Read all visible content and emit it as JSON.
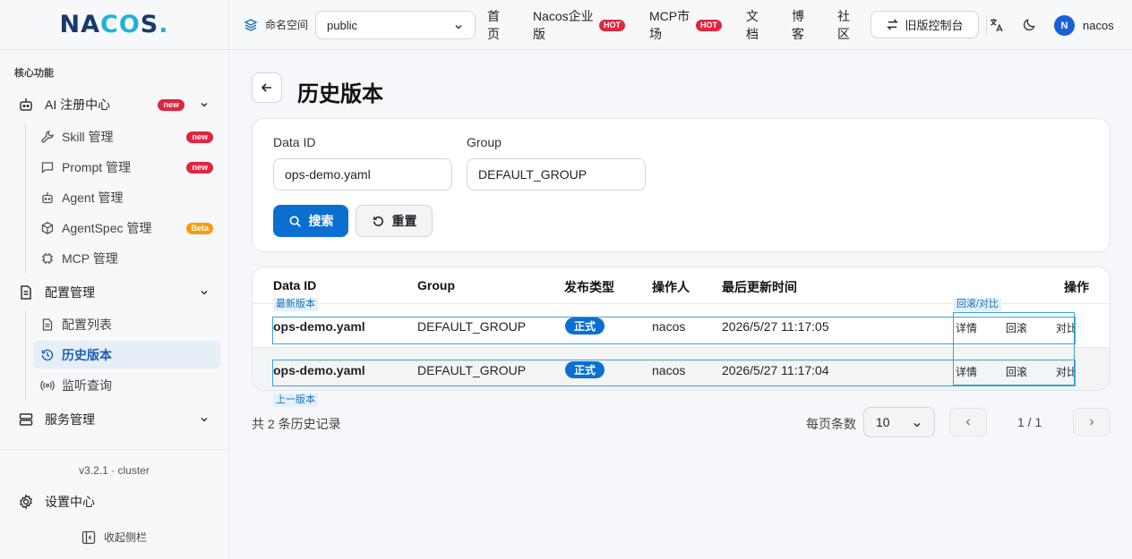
{
  "brand": {
    "logo": "NACOS."
  },
  "sidebar": {
    "section_title": "核心功能",
    "groups": [
      {
        "label": "AI 注册中心",
        "icon": "robot-icon",
        "badge": "new",
        "items": [
          {
            "label": "Skill 管理",
            "icon": "wrench-icon",
            "badge": "new"
          },
          {
            "label": "Prompt 管理",
            "icon": "chat-icon",
            "badge": "new"
          },
          {
            "label": "Agent 管理",
            "icon": "robot-icon"
          },
          {
            "label": "AgentSpec 管理",
            "icon": "cube-icon",
            "badge": "Beta"
          },
          {
            "label": "MCP 管理",
            "icon": "chip-icon"
          }
        ]
      },
      {
        "label": "配置管理",
        "icon": "file-icon",
        "items": [
          {
            "label": "配置列表",
            "icon": "file-icon"
          },
          {
            "label": "历史版本",
            "icon": "history-icon",
            "active": true
          },
          {
            "label": "监听查询",
            "icon": "radio-icon"
          }
        ]
      },
      {
        "label": "服务管理",
        "icon": "server-icon",
        "items": []
      }
    ],
    "version": "v3.2.1 · cluster",
    "settings": "设置中心",
    "collapse": "收起侧栏"
  },
  "header": {
    "namespace_label": "命名空间",
    "namespace_value": "public",
    "nav": [
      {
        "label": "首\n页"
      },
      {
        "label": "Nacos企业\n版",
        "badge": "HOT"
      },
      {
        "label": "MCP市\n场",
        "badge": "HOT"
      },
      {
        "label": "文\n档"
      },
      {
        "label": "博\n客"
      },
      {
        "label": "社\n区"
      }
    ],
    "legacy_console": "旧版控制台",
    "user": {
      "initial": "N",
      "name": "nacos"
    }
  },
  "page": {
    "title": "历史版本",
    "search": {
      "data_id_label": "Data ID",
      "data_id_value": "ops-demo.yaml",
      "group_label": "Group",
      "group_value": "DEFAULT_GROUP",
      "search_button": "搜索",
      "reset_button": "重置"
    },
    "table": {
      "columns": [
        "Data ID",
        "Group",
        "发布类型",
        "操作人",
        "最后更新时间",
        "操作"
      ],
      "rows": [
        {
          "data_id": "ops-demo.yaml",
          "group": "DEFAULT_GROUP",
          "type": "正式",
          "operator": "nacos",
          "updated": "2026/5/27 11:17:05",
          "actions": [
            "详情",
            "回滚",
            "对比"
          ]
        },
        {
          "data_id": "ops-demo.yaml",
          "group": "DEFAULT_GROUP",
          "type": "正式",
          "operator": "nacos",
          "updated": "2026/5/27 11:17:04",
          "actions": [
            "详情",
            "回滚",
            "对比"
          ]
        }
      ],
      "annotations": {
        "latest": "最新版本",
        "previous": "上一版本",
        "rollback_compare": "回滚/对比"
      }
    },
    "footer": {
      "total": "共 2 条历史记录",
      "per_page_label": "每页条数",
      "per_page_value": "10",
      "page_info": "1 / 1"
    }
  },
  "colors": {
    "primary": "#0a6fd1",
    "badge_red": "#e0253f",
    "badge_orange": "#f59e0b",
    "annotation": "#3aa3d6"
  }
}
